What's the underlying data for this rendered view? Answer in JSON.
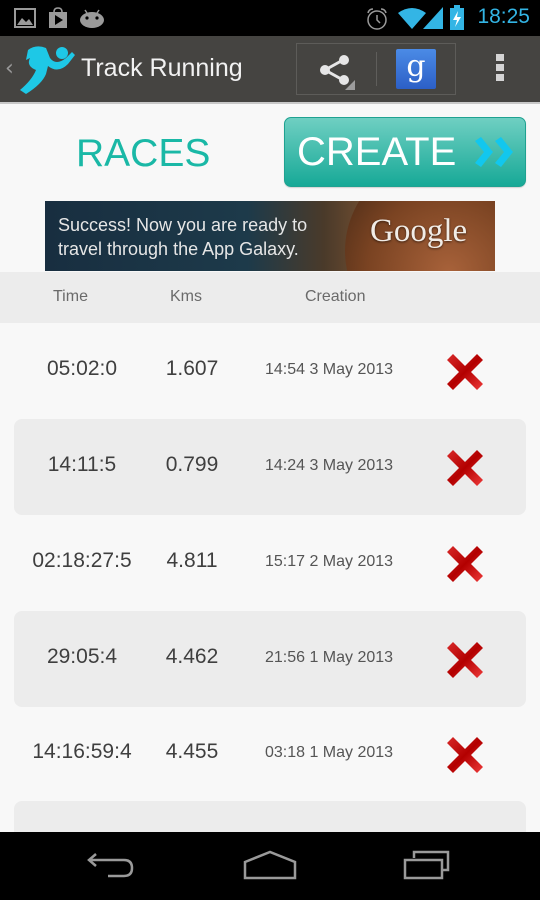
{
  "status_bar": {
    "time": "18:25",
    "left_icons": [
      "gallery-icon",
      "play-store-icon",
      "android-icon"
    ],
    "right_icons": [
      "alarm-icon",
      "wifi-icon",
      "signal-icon",
      "battery-charging-icon"
    ],
    "accent_color": "#33b5e5"
  },
  "action_bar": {
    "title": "Track Running",
    "back_glyph": "‹",
    "actions": [
      "share",
      "google"
    ],
    "google_glyph": "g",
    "overflow": "more-options"
  },
  "header": {
    "races_label": "RACES",
    "create_label": "CREATE",
    "accent_color": "#1ab8a6"
  },
  "ad": {
    "line1": "Success! Now you are ready to",
    "line2": "travel through the App Galaxy.",
    "brand": "Google"
  },
  "table": {
    "columns": [
      "Time",
      "Kms",
      "Creation"
    ],
    "rows": [
      {
        "time": "05:02:0",
        "kms": "1.607",
        "created": "14:54 3 May 2013"
      },
      {
        "time": "14:11:5",
        "kms": "0.799",
        "created": "14:24 3 May 2013"
      },
      {
        "time": "02:18:27:5",
        "kms": "4.811",
        "created": "15:17 2 May 2013"
      },
      {
        "time": "29:05:4",
        "kms": "4.462",
        "created": "21:56 1 May 2013"
      },
      {
        "time": "14:16:59:4",
        "kms": "4.455",
        "created": "03:18 1 May 2013"
      },
      {
        "time": "",
        "kms": "",
        "created": ""
      }
    ],
    "delete_color": "#cc1111"
  },
  "nav_bar": {
    "buttons": [
      "back",
      "home",
      "recents"
    ]
  }
}
